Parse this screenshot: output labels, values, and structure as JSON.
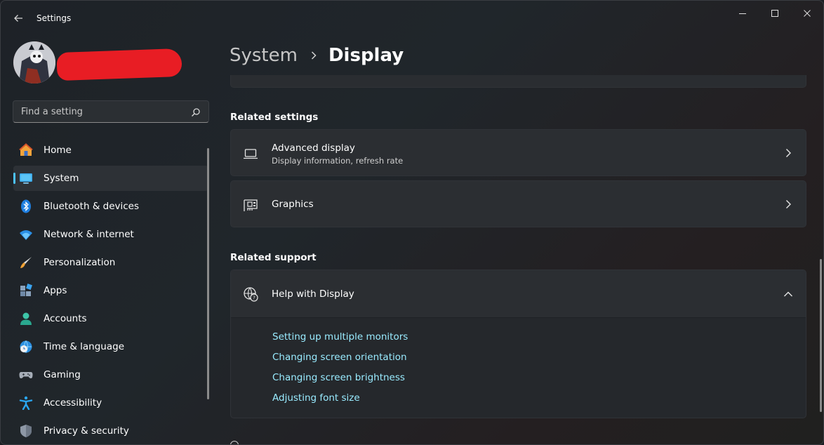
{
  "window": {
    "title": "Settings"
  },
  "profile": {
    "avatar_icon": "user-avatar"
  },
  "search": {
    "placeholder": "Find a setting"
  },
  "sidebar": {
    "items": [
      {
        "label": "Home",
        "icon": "home-icon"
      },
      {
        "label": "System",
        "icon": "system-icon",
        "active": true
      },
      {
        "label": "Bluetooth & devices",
        "icon": "bluetooth-icon"
      },
      {
        "label": "Network & internet",
        "icon": "wifi-icon"
      },
      {
        "label": "Personalization",
        "icon": "brush-icon"
      },
      {
        "label": "Apps",
        "icon": "apps-icon"
      },
      {
        "label": "Accounts",
        "icon": "person-icon"
      },
      {
        "label": "Time & language",
        "icon": "globe-clock-icon"
      },
      {
        "label": "Gaming",
        "icon": "gamepad-icon"
      },
      {
        "label": "Accessibility",
        "icon": "accessibility-icon"
      },
      {
        "label": "Privacy & security",
        "icon": "shield-icon"
      }
    ]
  },
  "breadcrumb": {
    "parent": "System",
    "current": "Display"
  },
  "related_settings": {
    "title": "Related settings",
    "cards": [
      {
        "title": "Advanced display",
        "subtitle": "Display information, refresh rate",
        "icon": "laptop-icon"
      },
      {
        "title": "Graphics",
        "subtitle": "",
        "icon": "graphics-card-icon"
      }
    ]
  },
  "related_support": {
    "title": "Related support",
    "help": {
      "title": "Help with Display",
      "icon": "globe-help-icon",
      "expanded": true,
      "links": [
        "Setting up multiple monitors",
        "Changing screen orientation",
        "Changing screen brightness",
        "Adjusting font size"
      ]
    }
  },
  "colors": {
    "accent": "#4cc2ff",
    "link": "#99ebff",
    "redaction": "#e81d24"
  }
}
